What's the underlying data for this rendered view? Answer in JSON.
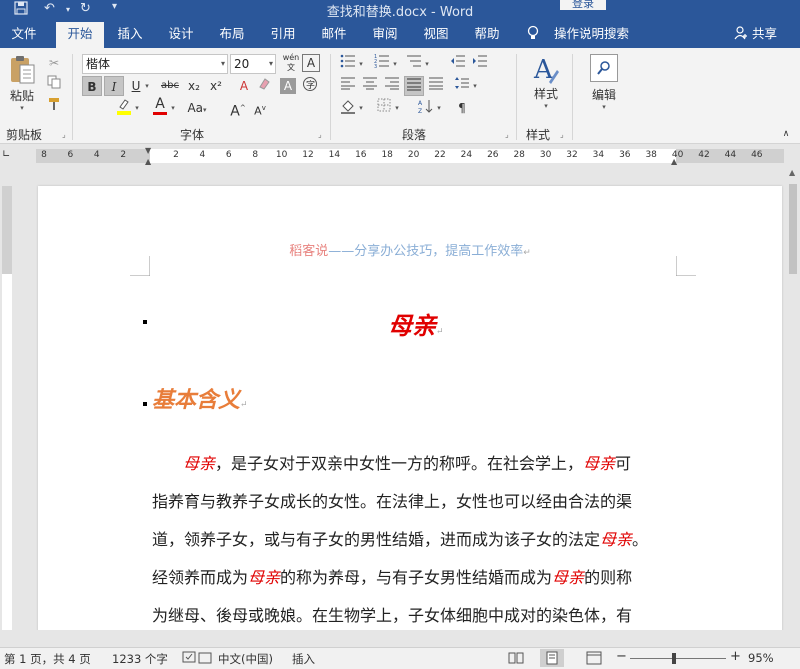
{
  "titlebar": {
    "save_icon": "save-icon",
    "undo_icon": "undo-icon",
    "redo_icon": "redo-icon",
    "title": "查找和替换.docx  -  Word",
    "login_label": "登录"
  },
  "tabs": [
    {
      "label": "文件"
    },
    {
      "label": "开始"
    },
    {
      "label": "插入"
    },
    {
      "label": "设计"
    },
    {
      "label": "布局"
    },
    {
      "label": "引用"
    },
    {
      "label": "邮件"
    },
    {
      "label": "审阅"
    },
    {
      "label": "视图"
    },
    {
      "label": "帮助"
    }
  ],
  "tell_me": "操作说明搜索",
  "share": "共享",
  "ribbon": {
    "clipboard": {
      "label": "剪贴板",
      "paste": "粘贴"
    },
    "font": {
      "label": "字体",
      "font_name": "楷体",
      "font_size": "20",
      "phonetic": "wén",
      "bold": "B",
      "italic": "I",
      "underline": "U",
      "strike": "abc",
      "subscript": "x₂",
      "superscript": "x²",
      "change_case": "Aa",
      "grow": "A",
      "shrink": "A",
      "highlight_color": "#ffff00",
      "font_color": "#e00000"
    },
    "paragraph": {
      "label": "段落"
    },
    "styles": {
      "label": "样式",
      "button": "样式"
    },
    "editing": {
      "button": "编辑"
    }
  },
  "ruler": {
    "numbers": [
      "8",
      "6",
      "4",
      "2",
      "2",
      "4",
      "6",
      "8",
      "10",
      "12",
      "14",
      "16",
      "18",
      "20",
      "22",
      "24",
      "26",
      "28",
      "30",
      "32",
      "34",
      "36",
      "38",
      "40",
      "42",
      "44",
      "46"
    ]
  },
  "document": {
    "header_a": "稻客说",
    "header_b": "——分享办公技巧，提高工作效率",
    "title": "母亲",
    "heading": "基本含义",
    "lines": [
      {
        "parts": [
          {
            "t": "母亲",
            "red": true
          },
          {
            "t": "，是子女对于双亲中女性一方的称呼。在社会学上，"
          },
          {
            "t": "母亲",
            "red": true
          },
          {
            "t": "可"
          }
        ]
      },
      {
        "parts": [
          {
            "t": "指养育与教养子女成长的女性。在法律上，女性也可以经由合法的渠"
          }
        ]
      },
      {
        "parts": [
          {
            "t": "道，领养子女，或与有子女的男性结婚，进而成为该子女的法定"
          },
          {
            "t": "母亲",
            "red": true
          },
          {
            "t": "。"
          }
        ]
      },
      {
        "parts": [
          {
            "t": "经领养而成为"
          },
          {
            "t": "母亲",
            "red": true
          },
          {
            "t": "的称为养母，与有子女男性结婚而成为"
          },
          {
            "t": "母亲",
            "red": true
          },
          {
            "t": "的则称"
          }
        ]
      },
      {
        "parts": [
          {
            "t": "为继母、後母或晚娘。在生物学上，子女体细胞中成对的染色体，有"
          }
        ]
      }
    ]
  },
  "status": {
    "page": "第 1 页，共 4 页",
    "words": "1233 个字",
    "language": "中文(中国)",
    "mode": "插入",
    "zoom": "95%"
  }
}
